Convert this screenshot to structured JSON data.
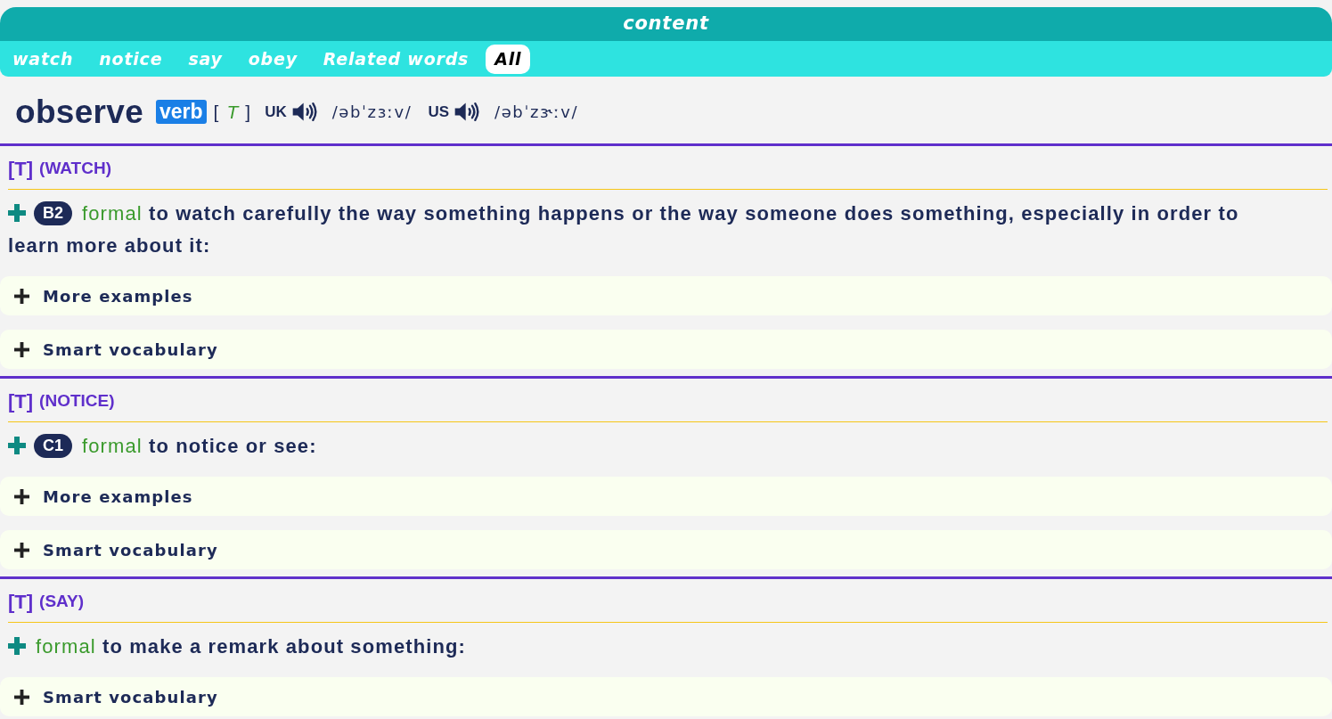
{
  "header": {
    "title": "content"
  },
  "nav": [
    {
      "label": "watch",
      "selected": false
    },
    {
      "label": "notice",
      "selected": false
    },
    {
      "label": "say",
      "selected": false
    },
    {
      "label": "obey",
      "selected": false
    },
    {
      "label": "Related words",
      "selected": false
    },
    {
      "label": "All",
      "selected": true
    }
  ],
  "entry": {
    "headword": "observe",
    "part_of_speech": "verb",
    "grammar": {
      "open": "[",
      "code": "T",
      "close": "]"
    },
    "pronunciations": [
      {
        "region": "UK",
        "ipa": "/əbˈzɜːv/"
      },
      {
        "region": "US",
        "ipa": "/əbˈzɝːv/"
      }
    ]
  },
  "senses": [
    {
      "grammar": "[T]",
      "guideword": "(WATCH)",
      "cefr": "B2",
      "register": "formal",
      "definition": "to watch carefully the way something happens or the way someone does something, especially in order to learn more about it:",
      "sections": [
        {
          "label": "More examples",
          "expanded": false
        },
        {
          "label": "Smart vocabulary",
          "expanded": false
        }
      ]
    },
    {
      "grammar": "[T]",
      "guideword": "(NOTICE)",
      "cefr": "C1",
      "register": "formal",
      "definition": "to notice or see:",
      "sections": [
        {
          "label": "More examples",
          "expanded": false
        },
        {
          "label": "Smart vocabulary",
          "expanded": false
        }
      ]
    },
    {
      "grammar": "[T]",
      "guideword": "(SAY)",
      "register": "formal",
      "definition": "to make a remark about something:",
      "sections": [
        {
          "label": "Smart vocabulary",
          "expanded": false
        }
      ]
    }
  ]
}
